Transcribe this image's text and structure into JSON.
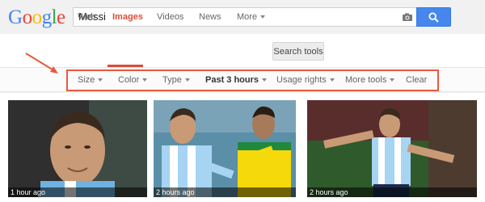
{
  "search": {
    "query": "Messi"
  },
  "tabs": [
    {
      "label": "Web"
    },
    {
      "label": "Images"
    },
    {
      "label": "Videos"
    },
    {
      "label": "News"
    },
    {
      "label": "More"
    }
  ],
  "search_tools_label": "Search tools",
  "tools": [
    {
      "label": "Size"
    },
    {
      "label": "Color"
    },
    {
      "label": "Type"
    },
    {
      "label": "Past 3 hours"
    },
    {
      "label": "Usage rights"
    },
    {
      "label": "More tools"
    },
    {
      "label": "Clear"
    }
  ],
  "images": [
    {
      "caption": "1 hour ago"
    },
    {
      "caption": "2 hours ago"
    },
    {
      "caption": "2 hours ago"
    }
  ],
  "colors": {
    "accent": "#dd4b39",
    "highlight_box": "#e8593f",
    "search_button": "#4787ed"
  }
}
